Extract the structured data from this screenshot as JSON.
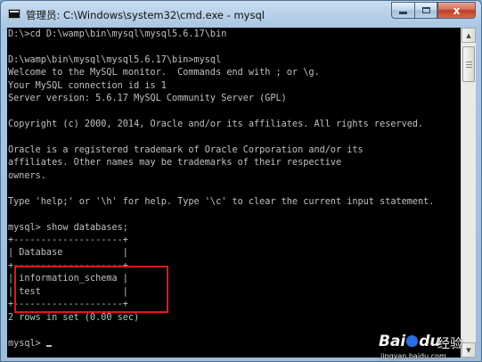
{
  "window": {
    "title": "管理员: C:\\Windows\\system32\\cmd.exe - mysql",
    "icon": "cmd-icon",
    "minimize_label": "",
    "maximize_label": "",
    "close_label": "x"
  },
  "console": {
    "lines": [
      "D:\\>cd D:\\wamp\\bin\\mysql\\mysql5.6.17\\bin",
      "",
      "D:\\wamp\\bin\\mysql\\mysql5.6.17\\bin>mysql",
      "Welcome to the MySQL monitor.  Commands end with ; or \\g.",
      "Your MySQL connection id is 1",
      "Server version: 5.6.17 MySQL Community Server (GPL)",
      "",
      "Copyright (c) 2000, 2014, Oracle and/or its affiliates. All rights reserved.",
      "",
      "Oracle is a registered trademark of Oracle Corporation and/or its",
      "affiliates. Other names may be trademarks of their respective",
      "owners.",
      "",
      "Type 'help;' or '\\h' for help. Type '\\c' to clear the current input statement.",
      "",
      "mysql> show databases;",
      "+--------------------+",
      "| Database           |",
      "+--------------------+",
      "| information_schema |",
      "| test               |",
      "+--------------------+",
      "2 rows in set (0.00 sec)",
      "",
      "mysql>"
    ]
  },
  "watermark": {
    "brand": "Bai",
    "brand_suffix": "du",
    "cn": "经验",
    "url": "jingyan.baidu.com"
  },
  "colors": {
    "console_bg": "#000000",
    "console_fg": "#c0c0c0",
    "highlight": "#e01818"
  }
}
